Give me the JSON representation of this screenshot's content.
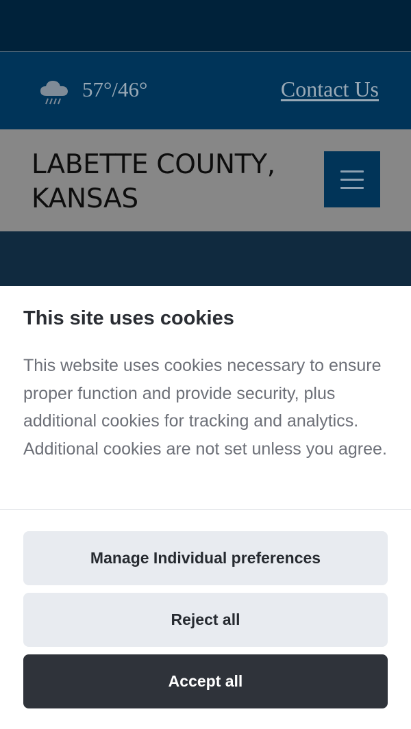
{
  "header": {
    "weather": {
      "icon": "rain-cloud-icon",
      "temperature": "57°/46°"
    },
    "contact_link": "Contact Us"
  },
  "site": {
    "title": "LABETTE COUNTY, KANSAS",
    "menu_icon": "hamburger-menu-icon"
  },
  "cookie_banner": {
    "title": "This site uses cookies",
    "body": "This website uses cookies necessary to ensure proper function and provide security, plus additional cookies for tracking and analytics. Additional cookies are not set unless you agree.",
    "manage_label": "Manage Individual preferences",
    "reject_label": "Reject all",
    "accept_label": "Accept all"
  },
  "colors": {
    "top_bar": "#00223a",
    "info_bar": "#003459",
    "title_bar": "#878787",
    "menu_button": "#013458",
    "light_button": "#e8ebf0",
    "dark_button": "#2f333a"
  }
}
